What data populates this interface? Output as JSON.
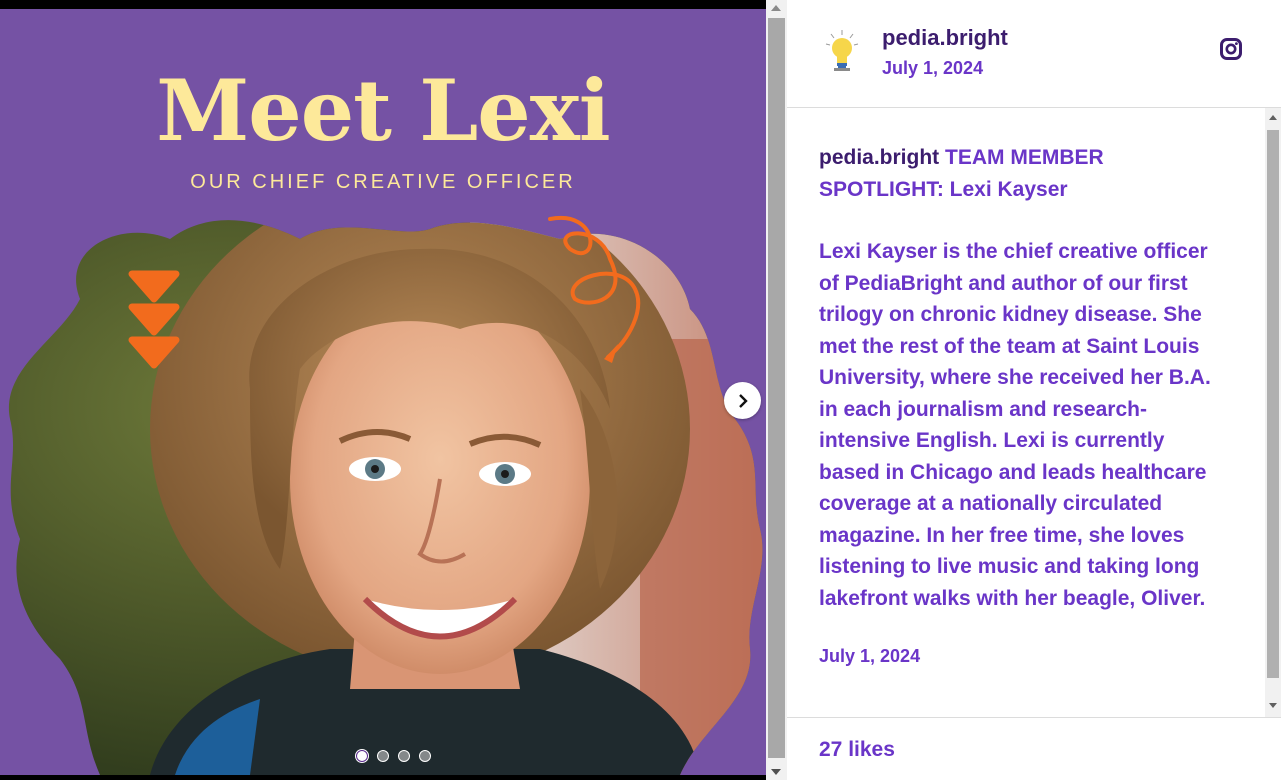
{
  "slide": {
    "title": "Meet Lexi",
    "subtitle": "OUR CHIEF CREATIVE OFFICER",
    "slide_count": 4,
    "active_slide": 1,
    "colors": {
      "background": "#7552a4",
      "title": "#fde99a",
      "accent": "#f26b1d"
    }
  },
  "post": {
    "username": "pedia.bright",
    "date": "July 1, 2024",
    "caption_title": "TEAM MEMBER SPOTLIGHT: Lexi Kayser",
    "caption_body": "Lexi Kayser is the chief creative officer of PediaBright and author of our first trilogy on chronic kidney disease. She met the rest of the team at Saint Louis University, where she received her B.A. in each journalism and research-intensive English. Lexi is currently based in Chicago and leads healthcare coverage at a nationally circulated magazine. In her free time, she loves listening to live music and taking long lakefront walks with her beagle, Oliver.",
    "caption_date": "July 1, 2024",
    "likes": "27 likes"
  },
  "icons": {
    "avatar": "lightbulb-icon",
    "platform": "instagram-icon",
    "next": "chevron-right-icon"
  }
}
